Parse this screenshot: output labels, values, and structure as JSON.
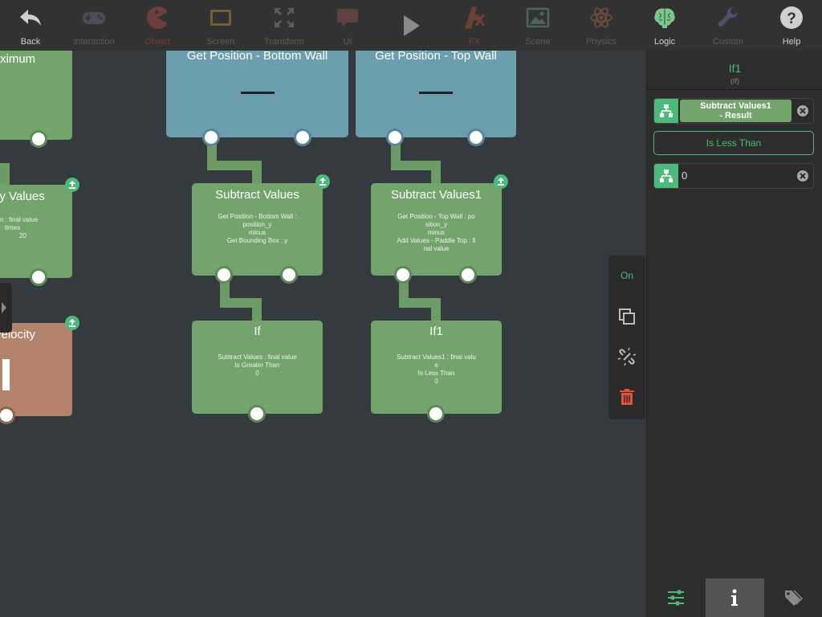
{
  "toolbar": {
    "items": [
      {
        "label": "Back",
        "icon": "back-arrow-icon"
      },
      {
        "label": "Interaction",
        "icon": "gamepad-icon"
      },
      {
        "label": "Object",
        "icon": "pacman-icon"
      },
      {
        "label": "Screen",
        "icon": "tablet-icon"
      },
      {
        "label": "Transform",
        "icon": "transform-icon"
      },
      {
        "label": "UI",
        "icon": "speech-bubble-icon"
      },
      {
        "label": "",
        "icon": "play-icon"
      },
      {
        "label": "FX",
        "icon": "fx-icon"
      },
      {
        "label": "Scene",
        "icon": "picture-icon"
      },
      {
        "label": "Physics",
        "icon": "atom-icon"
      },
      {
        "label": "Logic",
        "icon": "brain-icon"
      },
      {
        "label": "Custom",
        "icon": "wrench-icon"
      },
      {
        "label": "Help",
        "icon": "question-icon"
      }
    ]
  },
  "canvas": {
    "nodes": {
      "maximum": {
        "title": "ximum"
      },
      "multiply": {
        "title": "ly Values",
        "body": [
          "n : final value",
          "times",
          "20"
        ]
      },
      "velocity": {
        "title": "velocity"
      },
      "bottom_wall": {
        "title": "Get Position - Bottom Wall"
      },
      "top_wall": {
        "title": "Get Position - Top Wall"
      },
      "subtract": {
        "title": "Subtract Values",
        "body": [
          "Get Position - Bottom Wall :",
          "position_y",
          "minus",
          "Get Bounding Box : y"
        ]
      },
      "subtract1": {
        "title": "Subtract Values1",
        "body": [
          "Get Position - Top Wall : po",
          "sition_y",
          "minus",
          "Add Values - Paddle Top : fi",
          "nal value"
        ]
      },
      "if": {
        "title": "If",
        "body": [
          "Subtract Values : final value",
          "Is Greater Than",
          "0"
        ]
      },
      "if1": {
        "title": "If1",
        "body": [
          "Subtract Values1 : final valu",
          "e",
          "Is Less Than",
          "0"
        ]
      }
    }
  },
  "actions": {
    "on_label": "On"
  },
  "panel": {
    "title": "If1",
    "subtitle": "(If)",
    "left_operand": {
      "line1": "Subtract Values1",
      "line2": "- Result"
    },
    "comparator": "Is Less Than",
    "right_operand": "0"
  },
  "colors": {
    "accent": "#4cba7a",
    "node_green": "#73a46b",
    "node_blue": "#6c9fae",
    "node_brown": "#b4846a"
  }
}
